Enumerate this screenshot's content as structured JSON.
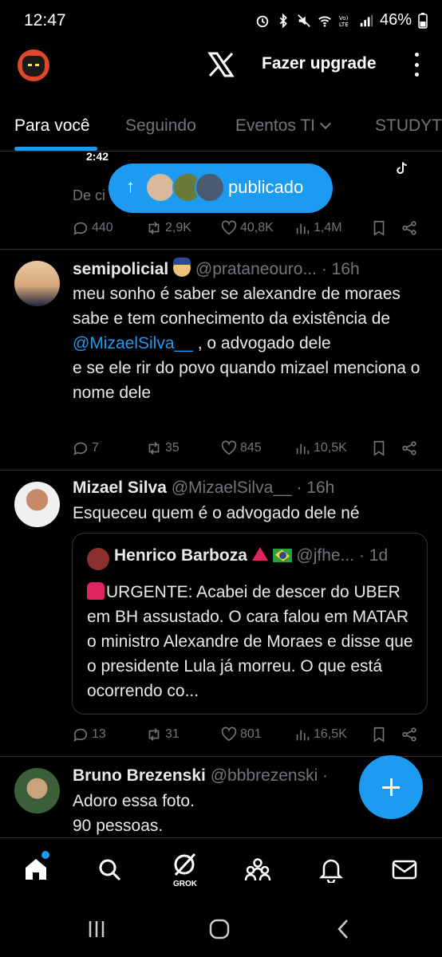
{
  "status_bar": {
    "time": "12:47",
    "battery": "46%",
    "icons": [
      "alarm-icon",
      "bluetooth-icon",
      "mute-icon",
      "wifi-icon",
      "volte-icon",
      "signal-icon",
      "battery-icon"
    ]
  },
  "header": {
    "upgrade_label": "Fazer upgrade",
    "logo": "x-logo-icon"
  },
  "tabs": [
    {
      "label": "Para você",
      "active": true
    },
    {
      "label": "Seguindo"
    },
    {
      "label": "Eventos TI"
    },
    {
      "label": "STUDYT"
    }
  ],
  "top_post_partial": {
    "video_time": "2:42",
    "caption_partial": "De ci",
    "replies": "440",
    "reposts": "2,9K",
    "likes": "40,8K",
    "views": "1,4M"
  },
  "new_posts_pill": {
    "label": "publicado"
  },
  "posts": [
    {
      "name": "semipolicial",
      "handle": "@prataneouro...",
      "time": "· 16h",
      "body_1": "meu sonho é saber se alexandre de moraes sabe e tem conhecimento da existência de ",
      "mention": "@MizaelSilva__",
      "body_2": " , o advogado dele",
      "body_3": "e se ele rir do povo quando mizael menciona o nome dele",
      "replies": "7",
      "reposts": "35",
      "likes": "845",
      "views": "10,5K"
    },
    {
      "name": "Mizael Silva",
      "handle": "@MizaelSilva__",
      "time": "· 16h",
      "body": "Esqueceu quem é o advogado dele né",
      "quote": {
        "name": "Henrico Barboza",
        "handle": "@jfhe...",
        "time": "· 1d",
        "body": "URGENTE: Acabei de descer do UBER em BH assustado. O cara falou em MATAR o ministro Alexandre de Moraes e disse que o presidente Lula já morreu. O que está ocorrendo co..."
      },
      "replies": "13",
      "reposts": "31",
      "likes": "801",
      "views": "16,5K"
    },
    {
      "name": "Bruno Brezenski",
      "handle": "@bbbrezenski",
      "time": "·",
      "body_1": "Adoro essa foto.",
      "body_2": "90 pessoas."
    }
  ],
  "bottom_nav": {
    "items": [
      "home-icon",
      "search-icon",
      "grok-icon",
      "communities-icon",
      "notifications-icon",
      "messages-icon"
    ],
    "grok_label": "GROK"
  },
  "colors": {
    "accent": "#1d9bf0",
    "background": "#000000",
    "muted": "#71767b",
    "text": "#e7e9ea"
  }
}
